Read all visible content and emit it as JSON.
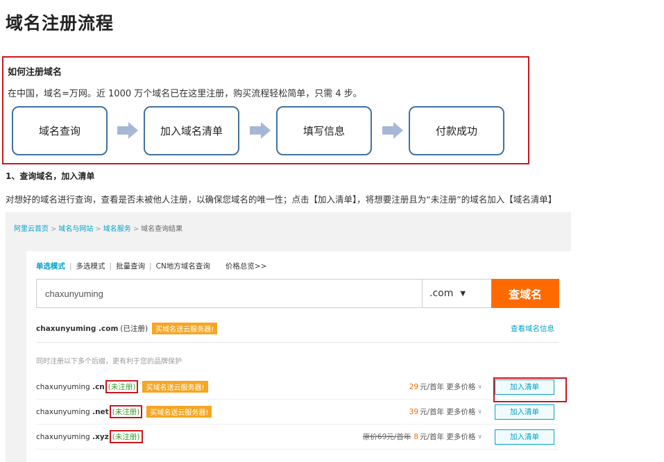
{
  "page_title": "域名注册流程",
  "intro": {
    "heading": "如何注册域名",
    "text": "在中国，域名=万网。近 1000 万个域名已在这里注册，购买流程轻松简单，只需 4 步。",
    "steps": [
      {
        "label": "域名查询"
      },
      {
        "label": "加入域名清单"
      },
      {
        "label": "填写信息"
      },
      {
        "label": "付款成功"
      }
    ],
    "arrow_color": "#a6b7d6",
    "box_border_color": "#c8161d",
    "step_border_color": "#41719c"
  },
  "section": {
    "title": "1、查询域名，加入清单",
    "desc": "对想好的域名进行查询，查看是否未被他人注册，以确保您域名的唯一性；点击【加入清单】，将想要注册且为“未注册”的域名加入【域名清单】"
  },
  "screenshot": {
    "breadcrumb": {
      "items": [
        "阿里云首页",
        "域名与网站",
        "域名服务",
        "域名查询结果"
      ],
      "separator": ">"
    },
    "modes": {
      "items": [
        "单选模式",
        "多选模式",
        "批量查询",
        "CN地方域名查询"
      ],
      "divider": "|",
      "overview": "价格总览>>"
    },
    "search": {
      "value": "chaxunyuming",
      "tld": ".com",
      "caret_icon": "triangle-down",
      "button": "查域名",
      "button_color": "#ff6a00"
    },
    "registered": {
      "domain": "chaxunyuming .com",
      "status": "(已注册)",
      "promo": "买域名送云服务器!",
      "info_link": "查看域名信息"
    },
    "hint": "同时注册以下多个后缀，更有利于您的品牌保护",
    "rows": [
      {
        "name": "chaxunyuming",
        "tld": ".cn",
        "status": "(未注册)",
        "promo": "买域名送云服务器!",
        "orig_price": "",
        "price": "29",
        "unit": "元/首年",
        "more": "更多价格",
        "add": "加入清单"
      },
      {
        "name": "chaxunyuming",
        "tld": ".net",
        "status": "(未注册)",
        "promo": "买域名送云服务器!",
        "orig_price": "",
        "price": "39",
        "unit": "元/首年",
        "more": "更多价格",
        "add": "加入清单"
      },
      {
        "name": "chaxunyuming",
        "tld": ".xyz",
        "status": "(未注册)",
        "promo": "",
        "orig_price": "原价69元/首年",
        "price": "8",
        "unit": "元/首年",
        "more": "更多价格",
        "add": "加入清单"
      }
    ],
    "accent_color": "#00a2ca",
    "free_color": "#3a9a2c",
    "promo_color": "#f5a623"
  }
}
